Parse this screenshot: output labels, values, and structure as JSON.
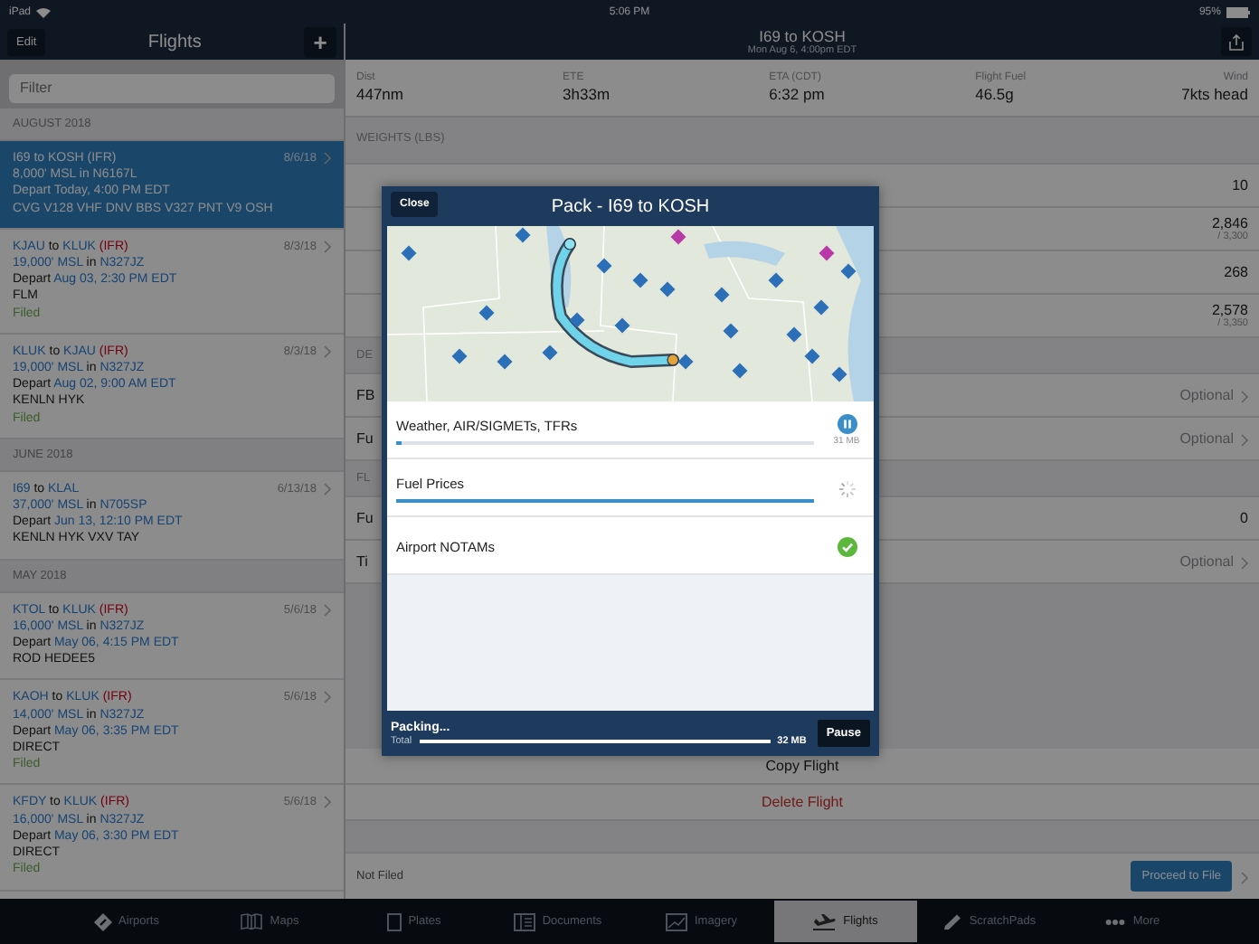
{
  "status_bar": {
    "device": "iPad",
    "time": "5:06 PM",
    "battery": "95%"
  },
  "sidebar": {
    "edit": "Edit",
    "title": "Flights",
    "add": "+",
    "filter_placeholder": "Filter",
    "groups": [
      {
        "title": "AUGUST 2018",
        "flights": [
          {
            "selected": true,
            "date": "8/6/18",
            "route": [
              {
                "text": "I69",
                "kind": "code"
              },
              {
                "text": "to",
                "kind": "plain"
              },
              {
                "text": "KOSH",
                "kind": "code"
              },
              {
                "text": "(IFR)",
                "kind": "rules"
              }
            ],
            "altitude": [
              {
                "text": "8,000' MSL",
                "kind": "code"
              },
              {
                "text": "in",
                "kind": "plain"
              },
              {
                "text": "N6167L",
                "kind": "code"
              }
            ],
            "departure": [
              {
                "text": "Depart",
                "kind": "plain"
              },
              {
                "text": "Today, 4:00 PM EDT",
                "kind": "code"
              }
            ],
            "waypoints": "CVG V128 VHF DNV BBS V327 PNT V9 OSH"
          },
          {
            "selected": false,
            "date": "8/3/18",
            "route": [
              {
                "text": "KJAU",
                "kind": "code"
              },
              {
                "text": "to",
                "kind": "plain"
              },
              {
                "text": "KLUK",
                "kind": "code"
              },
              {
                "text": "(IFR)",
                "kind": "rules"
              }
            ],
            "altitude": [
              {
                "text": "19,000' MSL",
                "kind": "code"
              },
              {
                "text": "in",
                "kind": "plain"
              },
              {
                "text": "N327JZ",
                "kind": "code"
              }
            ],
            "departure": [
              {
                "text": "Depart",
                "kind": "plain"
              },
              {
                "text": "Aug 03, 2:30 PM EDT",
                "kind": "code"
              }
            ],
            "waypoints": "FLM",
            "status": "Filed"
          },
          {
            "selected": false,
            "date": "8/3/18",
            "route": [
              {
                "text": "KLUK",
                "kind": "code"
              },
              {
                "text": "to",
                "kind": "plain"
              },
              {
                "text": "KJAU",
                "kind": "code"
              },
              {
                "text": "(IFR)",
                "kind": "rules"
              }
            ],
            "altitude": [
              {
                "text": "19,000' MSL",
                "kind": "code"
              },
              {
                "text": "in",
                "kind": "plain"
              },
              {
                "text": "N327JZ",
                "kind": "code"
              }
            ],
            "departure": [
              {
                "text": "Depart",
                "kind": "plain"
              },
              {
                "text": "Aug 02, 9:00 AM EDT",
                "kind": "code"
              }
            ],
            "waypoints": "KENLN HYK",
            "status": "Filed"
          }
        ]
      },
      {
        "title": "JUNE 2018",
        "flights": [
          {
            "selected": false,
            "date": "6/13/18",
            "route": [
              {
                "text": "I69",
                "kind": "code"
              },
              {
                "text": "to",
                "kind": "plain"
              },
              {
                "text": "KLAL",
                "kind": "code"
              }
            ],
            "altitude": [
              {
                "text": "37,000' MSL",
                "kind": "code"
              },
              {
                "text": "in",
                "kind": "plain"
              },
              {
                "text": "N705SP",
                "kind": "code"
              }
            ],
            "departure": [
              {
                "text": "Depart",
                "kind": "plain"
              },
              {
                "text": "Jun 13, 12:10 PM EDT",
                "kind": "code"
              }
            ],
            "waypoints": "KENLN HYK VXV TAY"
          }
        ]
      },
      {
        "title": "MAY 2018",
        "flights": [
          {
            "selected": false,
            "date": "5/6/18",
            "route": [
              {
                "text": "KTOL",
                "kind": "code"
              },
              {
                "text": "to",
                "kind": "plain"
              },
              {
                "text": "KLUK",
                "kind": "code"
              },
              {
                "text": "(IFR)",
                "kind": "rules"
              }
            ],
            "altitude": [
              {
                "text": "16,000' MSL",
                "kind": "code"
              },
              {
                "text": "in",
                "kind": "plain"
              },
              {
                "text": "N327JZ",
                "kind": "code"
              }
            ],
            "departure": [
              {
                "text": "Depart",
                "kind": "plain"
              },
              {
                "text": "May 06, 4:15 PM EDT",
                "kind": "code"
              }
            ],
            "waypoints": "ROD HEDEE5"
          },
          {
            "selected": false,
            "date": "5/6/18",
            "route": [
              {
                "text": "KAOH",
                "kind": "code"
              },
              {
                "text": "to",
                "kind": "plain"
              },
              {
                "text": "KLUK",
                "kind": "code"
              },
              {
                "text": "(IFR)",
                "kind": "rules"
              }
            ],
            "altitude": [
              {
                "text": "14,000' MSL",
                "kind": "code"
              },
              {
                "text": "in",
                "kind": "plain"
              },
              {
                "text": "N327JZ",
                "kind": "code"
              }
            ],
            "departure": [
              {
                "text": "Depart",
                "kind": "plain"
              },
              {
                "text": "May 06, 3:35 PM EDT",
                "kind": "code"
              }
            ],
            "waypoints": "DIRECT",
            "status": "Filed"
          },
          {
            "selected": false,
            "date": "5/6/18",
            "route": [
              {
                "text": "KFDY",
                "kind": "code"
              },
              {
                "text": "to",
                "kind": "plain"
              },
              {
                "text": "KLUK",
                "kind": "code"
              },
              {
                "text": "(IFR)",
                "kind": "rules"
              }
            ],
            "altitude": [
              {
                "text": "16,000' MSL",
                "kind": "code"
              },
              {
                "text": "in",
                "kind": "plain"
              },
              {
                "text": "N327JZ",
                "kind": "code"
              }
            ],
            "departure": [
              {
                "text": "Depart",
                "kind": "plain"
              },
              {
                "text": "May 06, 3:30 PM EDT",
                "kind": "code"
              }
            ],
            "waypoints": "DIRECT",
            "status": "Filed"
          }
        ]
      }
    ]
  },
  "detail": {
    "title": "I69 to KOSH",
    "subtitle": "Mon Aug 6, 4:00pm EDT",
    "stats": [
      {
        "label": "Dist",
        "value": "447nm"
      },
      {
        "label": "ETE",
        "value": "3h33m"
      },
      {
        "label": "ETA (CDT)",
        "value": "6:32 pm"
      },
      {
        "label": "Flight Fuel",
        "value": "46.5g"
      },
      {
        "label": "Wind",
        "value": "7kts head"
      }
    ],
    "rows": [
      {
        "kind": "header",
        "text": "WEIGHTS (LBS)"
      },
      {
        "kind": "value",
        "value": "10"
      },
      {
        "kind": "value",
        "value": "2,846",
        "sub": "/ 3,300"
      },
      {
        "kind": "value",
        "value": "268"
      },
      {
        "kind": "value",
        "value": "2,578",
        "sub": "/ 3,350"
      },
      {
        "kind": "header",
        "text": "DE"
      },
      {
        "kind": "option",
        "label": "FB",
        "value": "Optional"
      },
      {
        "kind": "option",
        "label": "Fu",
        "value": "Optional"
      },
      {
        "kind": "header",
        "text": "FL"
      },
      {
        "kind": "value",
        "label": "Fu",
        "value": "0"
      },
      {
        "kind": "option",
        "label": "Ti",
        "value": "Optional"
      }
    ],
    "actions": [
      {
        "label": "Copy Flight",
        "kind": "normal"
      },
      {
        "label": "Delete Flight",
        "kind": "destructive"
      }
    ],
    "filing_status": "Not Filed",
    "proceed": "Proceed to File"
  },
  "modal": {
    "close": "Close",
    "title": "Pack - I69 to KOSH",
    "items": [
      {
        "label": "Weather, AIR/SIGMETs, TFRs",
        "kind": "downloading",
        "level": 0.01,
        "size": "31 MB"
      },
      {
        "label": "Fuel Prices",
        "kind": "processing",
        "level": 1
      },
      {
        "label": "Airport NOTAMs",
        "kind": "complete"
      }
    ],
    "footer": {
      "status": "Packing...",
      "total_label": "Total",
      "level": 1,
      "size": "32 MB",
      "pause": "Pause"
    }
  },
  "tab_bar": [
    {
      "label": "Airports",
      "selected": false
    },
    {
      "label": "Maps",
      "selected": false
    },
    {
      "label": "Plates",
      "selected": false
    },
    {
      "label": "Documents",
      "selected": false
    },
    {
      "label": "Imagery",
      "selected": false
    },
    {
      "label": "Flights",
      "selected": true
    },
    {
      "label": "ScratchPads",
      "selected": false
    },
    {
      "label": "More",
      "selected": false
    }
  ]
}
